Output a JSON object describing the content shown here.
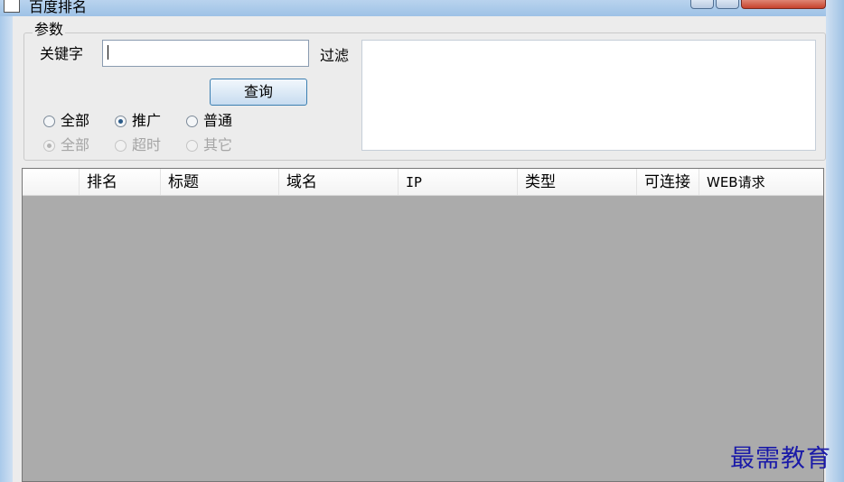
{
  "window": {
    "title": "百度排名"
  },
  "params": {
    "legend": "参数",
    "keyword_label": "关键字",
    "keyword_value": "",
    "filter_label": "过滤",
    "filter_value": "",
    "query_button": "查询",
    "type_radios": [
      {
        "label": "全部",
        "checked": false
      },
      {
        "label": "推广",
        "checked": true
      },
      {
        "label": "普通",
        "checked": false
      }
    ],
    "status_radios": [
      {
        "label": "全部",
        "checked": true,
        "disabled": true
      },
      {
        "label": "超时",
        "checked": false,
        "disabled": true
      },
      {
        "label": "其它",
        "checked": false,
        "disabled": true
      }
    ]
  },
  "table": {
    "columns": [
      "",
      "排名",
      "标题",
      "域名",
      "IP",
      "类型",
      "可连接",
      "WEB请求"
    ],
    "rows": []
  },
  "watermark": "最需教育",
  "colors": {
    "list_background": "#ababab",
    "accent": "#3c7fb1",
    "watermark": "#1a1aa8"
  }
}
